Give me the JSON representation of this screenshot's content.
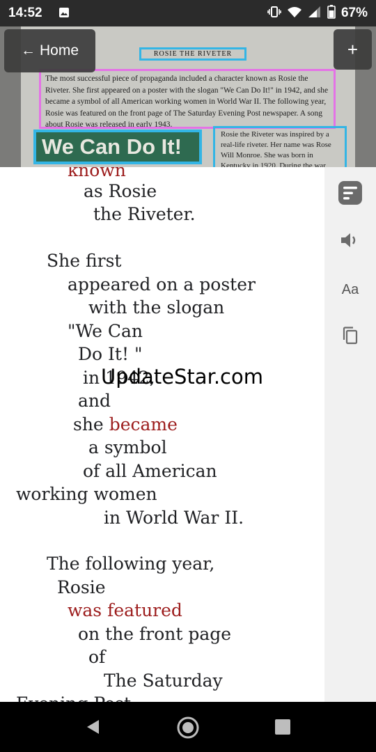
{
  "status_bar": {
    "time": "14:52",
    "battery": "67%"
  },
  "camera_view": {
    "doc_title": "ROSIE THE RIVETER",
    "paragraph1": "The most successful piece of propaganda included a character known as Rosie the Riveter. She first appeared on a poster with the slogan \"We Can Do It!\" in 1942, and she became a symbol of all American working women in World War II. The following year, Rosie was featured on the front page of The Saturday Evening Post newspaper. A song about Rosie was released in early 1943.",
    "poster_text": "We Can Do It!",
    "paragraph2": "Rosie the Riveter was inspired by a real-life riveter. Her name was Rose Will Monroe. She was born in Kentucky in 1920. During the war,"
  },
  "buttons": {
    "home_label": "Home",
    "add_label": "+"
  },
  "reader": {
    "lines": [
      {
        "text": "known",
        "highlight": true
      },
      {
        "text": "as Rosie",
        "highlight": false
      },
      {
        "text": "the Riveter.",
        "highlight": false
      },
      {
        "text": "She first",
        "highlight": false
      },
      {
        "text": "appeared on a poster",
        "highlight": false
      },
      {
        "text": "with the slogan",
        "highlight": false
      },
      {
        "text": "\"We Can",
        "highlight": false
      },
      {
        "text": "Do It! \"",
        "highlight": false
      },
      {
        "text": "in 1942,",
        "highlight": false
      },
      {
        "text": "and",
        "highlight": false
      },
      {
        "text": "she became",
        "highlight": false
      },
      {
        "text": "a symbol",
        "highlight": false
      },
      {
        "text": "of all American",
        "highlight": false
      },
      {
        "text": "working women",
        "highlight": false
      },
      {
        "text": "in World War II.",
        "highlight": false
      },
      {
        "text": "The following year,",
        "highlight": false
      },
      {
        "text": "Rosie",
        "highlight": false
      },
      {
        "text": "was featured",
        "highlight": true
      },
      {
        "text": "on the front page",
        "highlight": false
      },
      {
        "text": "of",
        "highlight": false
      },
      {
        "text": "The Saturday",
        "highlight": false
      },
      {
        "text": "Evening Post",
        "highlight": false
      }
    ],
    "became_word": "became"
  },
  "watermark": "UpdateStar.com",
  "sidebar": {
    "text_size_label": "Aa"
  }
}
